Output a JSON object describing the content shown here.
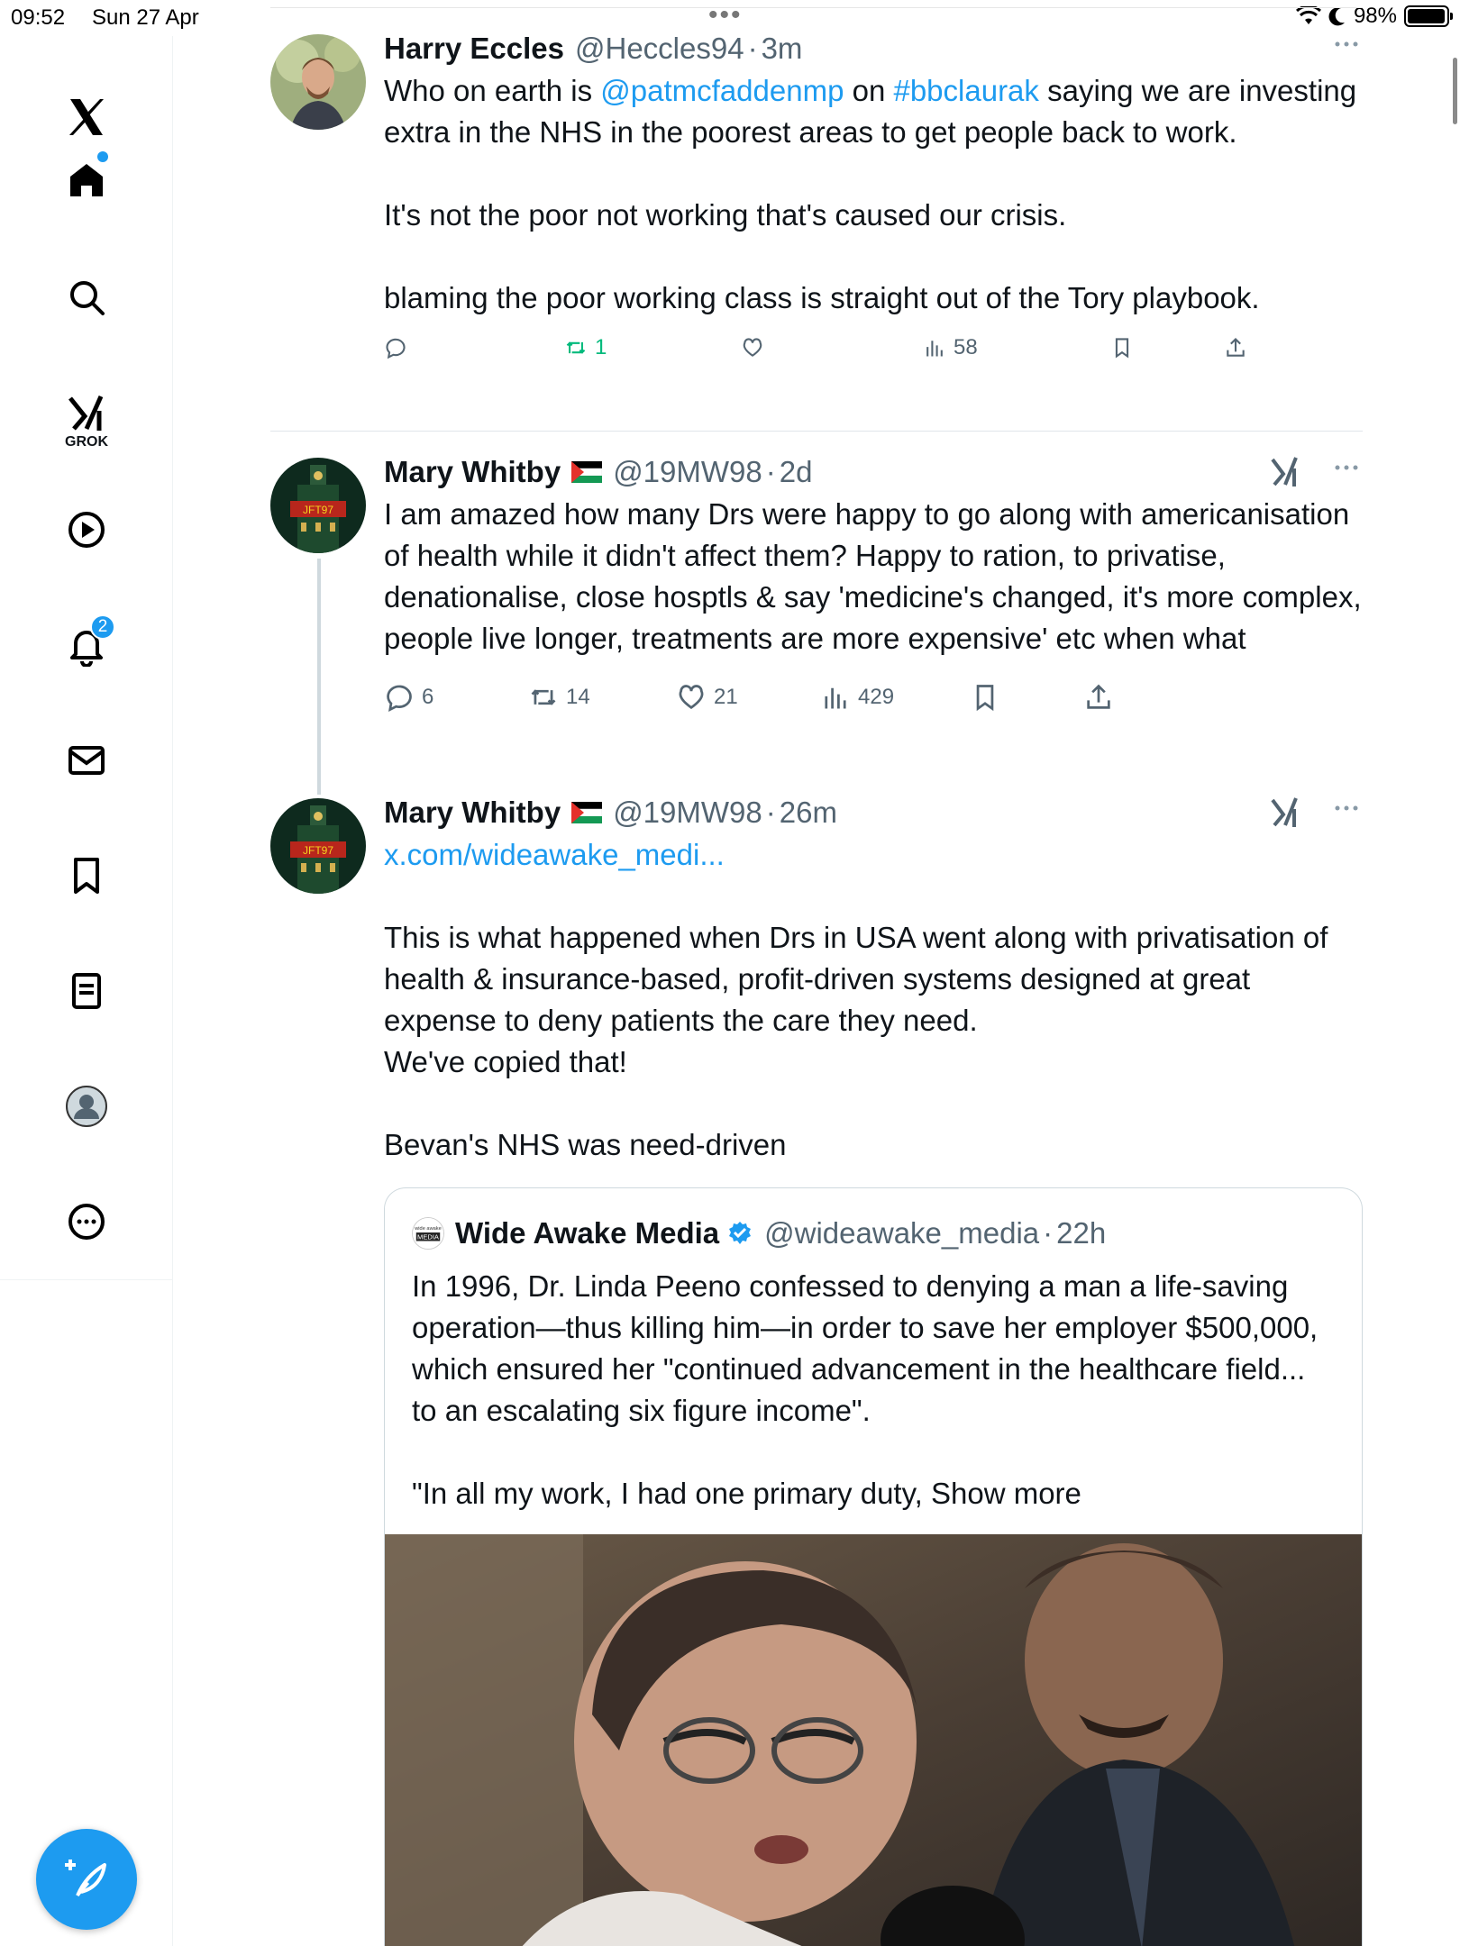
{
  "status_bar": {
    "time": "09:52",
    "date": "Sun 27 Apr",
    "battery": "98%",
    "battery_level": 0.98
  },
  "sidebar": {
    "notification_count": "2",
    "grok_label": "GROK"
  },
  "tweets": [
    {
      "name": "Harry Eccles",
      "handle": "@Heccles94",
      "separator": "·",
      "time": "3m",
      "text_pre": "Who on earth is ",
      "mention": "@patmcfaddenmp",
      "text_mid": " on ",
      "hashtag": "#bbclaurak",
      "text_post": " saying we are investing extra in the NHS in the poorest areas to get people back to work.\n\nIt's not the poor not working that's caused our crisis.\n\nblaming the poor working class is straight out of the Tory playbook.",
      "replies": "",
      "retweets": "1",
      "likes": "",
      "views": "58"
    },
    {
      "name": "Mary Whitby",
      "handle": "@19MW98",
      "separator": "·",
      "time": "2d",
      "text": "I am amazed how many Drs were happy to go along with americanisation of health while it didn't affect them? Happy to ration, to privatise, denationalise, close hosptls & say 'medicine's changed, it's more complex, people live longer, treatments are more expensive' etc when what",
      "replies": "6",
      "retweets": "14",
      "likes": "21",
      "views": "429",
      "avatar_text": "JFT97"
    },
    {
      "name": "Mary Whitby",
      "handle": "@19MW98",
      "separator": "·",
      "time": "26m",
      "link": "x.com/wideawake_medi...",
      "text": "This is what happened when Drs in USA went along with privatisation of health & insurance-based, profit-driven systems designed at great expense to deny patients the care they need.\nWe've copied that!\n\nBevan's NHS was need-driven",
      "avatar_text": "JFT97",
      "quote": {
        "name": "Wide Awake Media",
        "handle": "@wideawake_media",
        "separator": "·",
        "time": "22h",
        "avatar_text": "MEDIA",
        "text": "In 1996, Dr. Linda Peeno confessed to denying a man a life-saving operation—thus killing him—in order to save her employer $500,000, which ensured her \"continued advancement in the healthcare field... to an escalating six figure income\".\n\n\"In all my work, I had one primary duty, ",
        "show_more": "Show more"
      }
    }
  ],
  "colors": {
    "accent": "#1d9bf0",
    "secondary_text": "#536471",
    "retweet_green": "#00ba7c"
  }
}
